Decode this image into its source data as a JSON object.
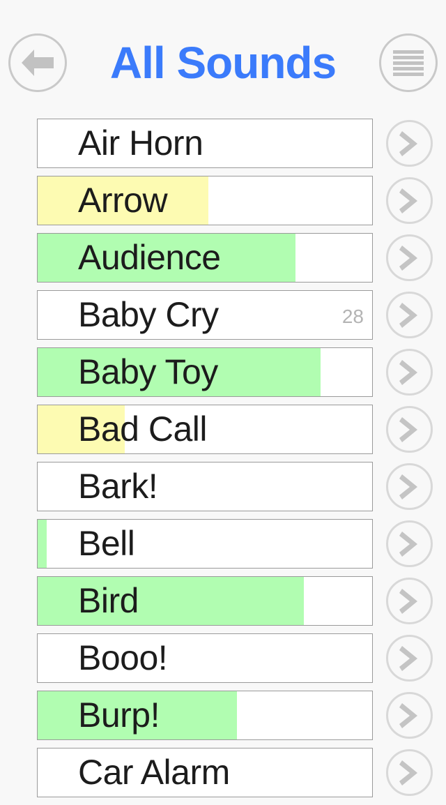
{
  "header": {
    "title": "All Sounds",
    "back_icon": "back-arrow-icon",
    "menu_icon": "hamburger-menu-icon",
    "title_color": "#3b7bfb",
    "circle_border_color": "#c9c9c9"
  },
  "colors": {
    "background": "#f8f8f8",
    "row_border": "#9a9a9a",
    "fill_green": "#b1fdb1",
    "fill_yellow": "#fdfbb2",
    "count_text": "#b4b4b4",
    "label_text": "#1c1c1c",
    "chevron_ring": "#d8d8d8",
    "chevron_glyph": "#c4c4c4"
  },
  "list": {
    "chevron_icon": "chevron-right-icon",
    "rows": [
      {
        "label": "Air Horn",
        "fill_percent": 0,
        "fill_color": "none",
        "count": ""
      },
      {
        "label": "Arrow",
        "fill_percent": 51,
        "fill_color": "yellow",
        "count": ""
      },
      {
        "label": "Audience",
        "fill_percent": 77,
        "fill_color": "green",
        "count": ""
      },
      {
        "label": "Baby Cry",
        "fill_percent": 0,
        "fill_color": "none",
        "count": "28"
      },
      {
        "label": "Baby Toy",
        "fill_percent": 84.5,
        "fill_color": "green",
        "count": ""
      },
      {
        "label": "Bad Call",
        "fill_percent": 26,
        "fill_color": "yellow",
        "count": ""
      },
      {
        "label": "Bark!",
        "fill_percent": 0,
        "fill_color": "none",
        "count": ""
      },
      {
        "label": "Bell",
        "fill_percent": 2.7,
        "fill_color": "green",
        "count": ""
      },
      {
        "label": "Bird",
        "fill_percent": 79.5,
        "fill_color": "green",
        "count": ""
      },
      {
        "label": "Booo!",
        "fill_percent": 0,
        "fill_color": "none",
        "count": ""
      },
      {
        "label": "Burp!",
        "fill_percent": 59.6,
        "fill_color": "green",
        "count": ""
      },
      {
        "label": "Car Alarm",
        "fill_percent": 0,
        "fill_color": "none",
        "count": ""
      }
    ]
  }
}
